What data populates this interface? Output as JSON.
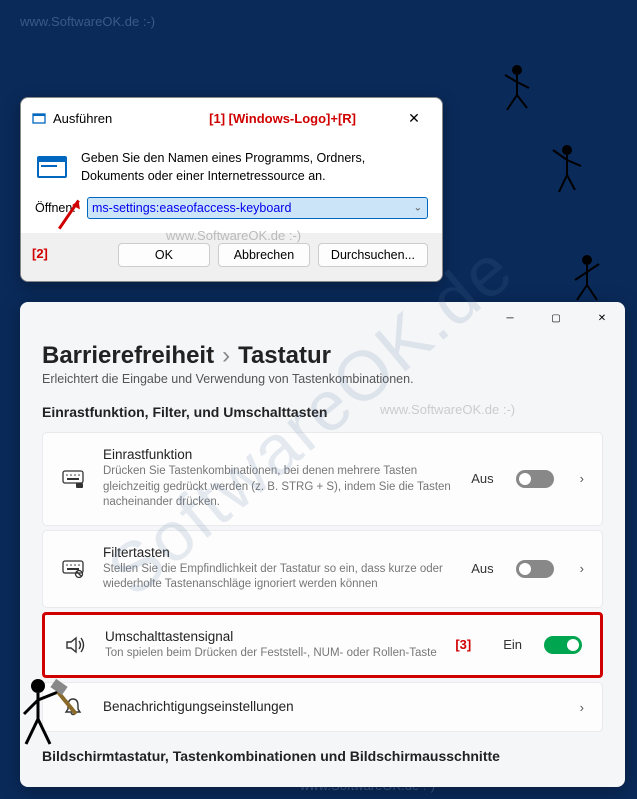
{
  "watermarks": {
    "top": "www.SoftwareOK.de  :-)",
    "mid1": "www.SoftwareOK.de  :-)",
    "mid2": "www.SoftwareOK.de  :-)",
    "bottom": "www.SoftwareOK.de  :-)",
    "big": "SoftwareOK.de"
  },
  "annotations": {
    "a1": "[1]  [Windows-Logo]+[R]",
    "a2": "[2]",
    "a3": "[3]"
  },
  "run": {
    "title": "Ausführen",
    "description": "Geben Sie den Namen eines Programms, Ordners, Dokuments oder einer Internetressource an.",
    "open_label": "Öffnen:",
    "input_value": "ms-settings:easeofaccess-keyboard",
    "ok": "OK",
    "cancel": "Abbrechen",
    "browse": "Durchsuchen..."
  },
  "settings": {
    "breadcrumb_parent": "Barrierefreiheit",
    "breadcrumb_current": "Tastatur",
    "subtitle": "Erleichtert die Eingabe und Verwendung von Tastenkombinationen.",
    "section1": "Einrastfunktion, Filter, und Umschalttasten",
    "sticky": {
      "title": "Einrastfunktion",
      "desc": "Drücken Sie Tastenkombinationen, bei denen mehrere Tasten gleichzeitig gedrückt werden (z. B. STRG + S), indem Sie die Tasten nacheinander drücken.",
      "state": "Aus"
    },
    "filter": {
      "title": "Filtertasten",
      "desc": "Stellen Sie die Empfindlichkeit der Tastatur so ein, dass kurze oder wiederholte Tastenanschläge ignoriert werden können",
      "state": "Aus"
    },
    "togglekeys": {
      "title": "Umschalttastensignal",
      "desc": "Ton spielen beim Drücken der Feststell-, NUM- oder Rollen-Taste",
      "state": "Ein"
    },
    "notifications": "Benachrichtigungseinstellungen",
    "section2": "Bildschirmtastatur, Tastenkombinationen und Bildschirmausschnitte"
  }
}
